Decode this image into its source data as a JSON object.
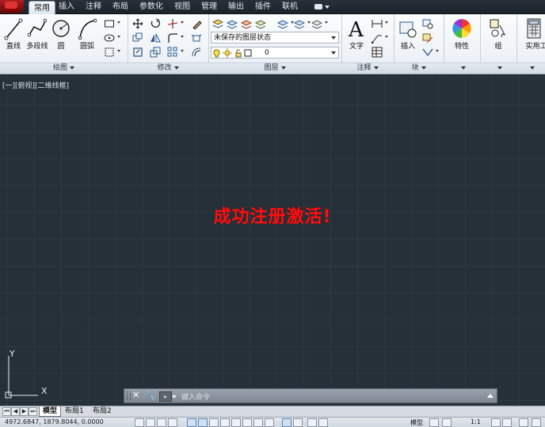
{
  "menu_tabs": [
    "常用",
    "插入",
    "注释",
    "布局",
    "参数化",
    "视图",
    "管理",
    "输出",
    "插件",
    "联机"
  ],
  "active_tab": "常用",
  "draw_panel": {
    "title": "绘图",
    "tools": [
      "直线",
      "多段线",
      "圆",
      "圆弧"
    ]
  },
  "modify_panel": {
    "title": "修改"
  },
  "layers_panel": {
    "title": "图层",
    "layer_state_combo": "未保存的图层状态",
    "current_layer": "0"
  },
  "annotation_panel": {
    "title": "注释",
    "text_tool": "文字"
  },
  "block_panel": {
    "title": "块",
    "insert_tool": "插入"
  },
  "properties_tool": "特性",
  "group_tool": "组",
  "utilities_tool": "实用工",
  "viewport": {
    "label": "[一][俯视][二维线框]",
    "message": "成功注册激活!",
    "ucs_y": "Y",
    "ucs_x": "X"
  },
  "command_line": {
    "placeholder": "键入命令"
  },
  "layout_tabs": [
    "模型",
    "布局1",
    "布局2"
  ],
  "status_bar": {
    "coordinates": "4972.6847, 1879.8044, 0.0000",
    "model_label": "模型",
    "scale": "1:1"
  },
  "colors": {
    "canvas_bg": "#253038",
    "grid_line": "#2d3a44",
    "message": "#ff1010",
    "app_button": "#b22020"
  }
}
